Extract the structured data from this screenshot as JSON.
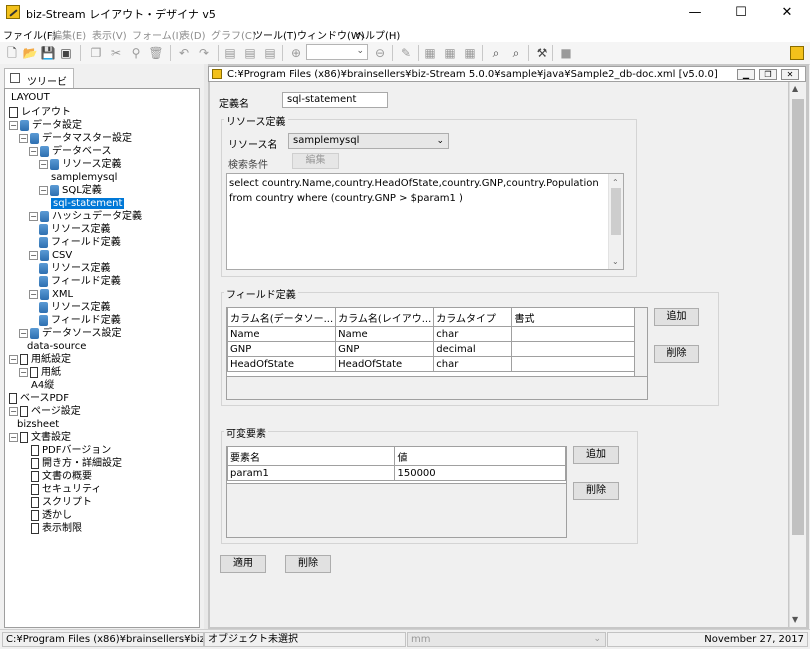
{
  "window": {
    "title": "biz-Stream レイアウト・デザイナ v5",
    "controls": {
      "minimize": "—",
      "maximize": "☐",
      "close": "✕"
    }
  },
  "menu": [
    {
      "label": "ファイル(F)",
      "disabled": false
    },
    {
      "label": "編集(E)",
      "disabled": true
    },
    {
      "label": "表示(V)",
      "disabled": true
    },
    {
      "label": "フォーム(I)",
      "disabled": true
    },
    {
      "label": "表(D)",
      "disabled": true
    },
    {
      "label": "グラフ(C)",
      "disabled": true
    },
    {
      "label": "ツール(T)",
      "disabled": false
    },
    {
      "label": "ウィンドウ(W)",
      "disabled": false
    },
    {
      "label": "ヘルプ(H)",
      "disabled": false
    }
  ],
  "toolbar_icons": [
    "new-file-icon",
    "open-folder-icon",
    "save-icon",
    "save-all-icon",
    "copy-icon",
    "cut-icon",
    "paste-icon",
    "delete-icon",
    "undo-icon",
    "redo-icon",
    "page-icon",
    "page-icon",
    "page-icon",
    "zoom-in-icon",
    "zoom-out-icon",
    "edit-icon",
    "align-icon",
    "align-icon",
    "align-icon",
    "preview-icon",
    "preview-icon",
    "debug-icon",
    "stop-icon"
  ],
  "tree": {
    "tab_label": "ツリービュー",
    "root_label": "LAYOUT",
    "nodes": [
      {
        "label": "レイアウト",
        "icon": "layout",
        "toggle": ""
      },
      {
        "label": "データ設定",
        "icon": "db",
        "toggle": "−"
      },
      {
        "label": "データマスター設定",
        "icon": "db",
        "toggle": "−"
      },
      {
        "label": "データベース",
        "icon": "db",
        "toggle": "−"
      },
      {
        "label": "リソース定義",
        "icon": "db",
        "toggle": "−"
      },
      {
        "label": "samplemysql",
        "icon": "leaf",
        "toggle": ""
      },
      {
        "label": "SQL定義",
        "icon": "db",
        "toggle": "−"
      },
      {
        "label": "sql-statement",
        "icon": "leaf",
        "toggle": "",
        "selected": true
      },
      {
        "label": "ハッシュデータ定義",
        "icon": "db",
        "toggle": "−"
      },
      {
        "label": "リソース定義",
        "icon": "db",
        "toggle": ""
      },
      {
        "label": "フィールド定義",
        "icon": "db",
        "toggle": ""
      },
      {
        "label": "CSV",
        "icon": "db",
        "toggle": "−"
      },
      {
        "label": "リソース定義",
        "icon": "db",
        "toggle": ""
      },
      {
        "label": "フィールド定義",
        "icon": "db",
        "toggle": ""
      },
      {
        "label": "XML",
        "icon": "db",
        "toggle": "−"
      },
      {
        "label": "リソース定義",
        "icon": "db",
        "toggle": ""
      },
      {
        "label": "フィールド定義",
        "icon": "db",
        "toggle": ""
      },
      {
        "label": "データソース設定",
        "icon": "db",
        "toggle": "−"
      },
      {
        "label": "data-source",
        "icon": "leaf",
        "toggle": ""
      },
      {
        "label": "用紙設定",
        "icon": "doc",
        "toggle": "−"
      },
      {
        "label": "用紙",
        "icon": "doc",
        "toggle": "−"
      },
      {
        "label": "A4縦",
        "icon": "leaf",
        "toggle": ""
      },
      {
        "label": "ベースPDF",
        "icon": "doc",
        "toggle": ""
      },
      {
        "label": "ページ設定",
        "icon": "doc",
        "toggle": "−"
      },
      {
        "label": "bizsheet",
        "icon": "leaf",
        "toggle": ""
      },
      {
        "label": "文書設定",
        "icon": "doc",
        "toggle": "−"
      },
      {
        "label": "PDFバージョン",
        "icon": "doc",
        "toggle": ""
      },
      {
        "label": "開き方・詳細設定",
        "icon": "doc",
        "toggle": ""
      },
      {
        "label": "文書の概要",
        "icon": "doc",
        "toggle": ""
      },
      {
        "label": "セキュリティ",
        "icon": "doc",
        "toggle": ""
      },
      {
        "label": "スクリプト",
        "icon": "doc",
        "toggle": ""
      },
      {
        "label": "透かし",
        "icon": "doc",
        "toggle": ""
      },
      {
        "label": "表示制限",
        "icon": "doc",
        "toggle": ""
      }
    ]
  },
  "child_window": {
    "title": "C:¥Program Files (x86)¥brainsellers¥biz-Stream 5.0.0¥sample¥java¥Sample2_db-doc.xml [v5.0.0]"
  },
  "form": {
    "def_name_label": "定義名",
    "def_name_value": "sql-statement",
    "resource_group_title": "リソース定義",
    "resource_name_label": "リソース名",
    "resource_name_value": "samplemysql",
    "search_label": "検索条件",
    "edit_button": "編集",
    "sql_text": "select country.Name,country.HeadOfState,country.GNP,country.Population from country where (country.GNP > $param1 )",
    "field_group_title": "フィールド定義",
    "field_columns": [
      "カラム名(データソー...",
      "カラム名(レイアウ...",
      "カラムタイプ",
      "書式"
    ],
    "field_rows": [
      [
        "Name",
        "Name",
        "char",
        ""
      ],
      [
        "GNP",
        "GNP",
        "decimal",
        ""
      ],
      [
        "HeadOfState",
        "HeadOfState",
        "char",
        ""
      ]
    ],
    "field_add": "追加",
    "field_delete": "削除",
    "var_group_title": "可変要素",
    "var_columns": [
      "要素名",
      "値"
    ],
    "var_rows": [
      [
        "param1",
        "150000"
      ]
    ],
    "var_add": "追加",
    "var_delete": "削除",
    "apply_button": "適用",
    "delete_button": "削除"
  },
  "status": {
    "path": "C:¥Program Files (x86)¥brainsellers¥biz...",
    "selection": "オブジェクト未選択",
    "unit": "mm",
    "date": "November 27, 2017"
  }
}
